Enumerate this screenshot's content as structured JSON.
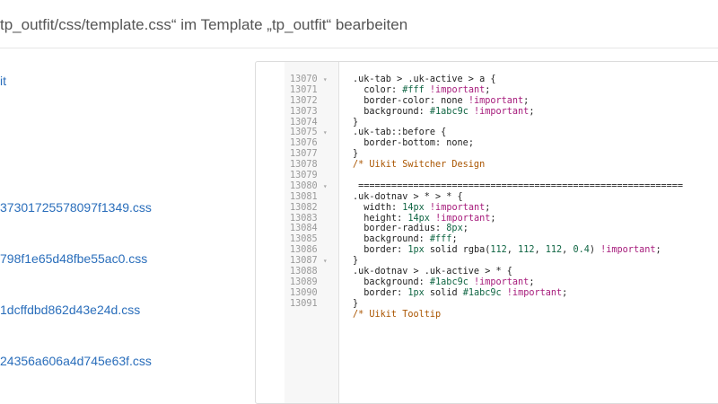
{
  "header": {
    "title": "tp_outfit/css/template.css“ im Template „tp_outfit“ bearbeiten"
  },
  "file_tree": {
    "items": [
      {
        "label": "it"
      },
      {
        "label": "37301725578097f1349.css"
      },
      {
        "label": "798f1e65d48fbe55ac0.css"
      },
      {
        "label": "1dcffdbd862d43e24d.css"
      },
      {
        "label": "24356a606a4d745e63f.css"
      }
    ]
  },
  "editor": {
    "lines": [
      {
        "num": "13070",
        "fold": "▾",
        "code": ".uk-tab > .uk-active > a {"
      },
      {
        "num": "13071",
        "fold": "",
        "code": "  color: #fff !important;"
      },
      {
        "num": "13072",
        "fold": "",
        "code": "  border-color: none !important;"
      },
      {
        "num": "13073",
        "fold": "",
        "code": "  background: #1abc9c !important;"
      },
      {
        "num": "13074",
        "fold": "",
        "code": "}"
      },
      {
        "num": "13075",
        "fold": "▾",
        "code": ".uk-tab::before {"
      },
      {
        "num": "13076",
        "fold": "",
        "code": "  border-bottom: none;"
      },
      {
        "num": "13077",
        "fold": "",
        "code": "}"
      },
      {
        "num": "13078",
        "fold": "",
        "code": "/* Uikit Switcher Design"
      },
      {
        "num": "13079",
        "fold": "",
        "code": ""
      },
      {
        "num": "13080",
        "fold": "▾",
        "code": " ==========================================================="
      },
      {
        "num": "13081",
        "fold": "",
        "code": ".uk-dotnav > * > * {"
      },
      {
        "num": "13082",
        "fold": "",
        "code": "  width: 14px !important;"
      },
      {
        "num": "13083",
        "fold": "",
        "code": "  height: 14px !important;"
      },
      {
        "num": "13084",
        "fold": "",
        "code": "  border-radius: 8px;"
      },
      {
        "num": "13085",
        "fold": "",
        "code": "  background: #fff;"
      },
      {
        "num": "13086",
        "fold": "",
        "code": "  border: 1px solid rgba(112, 112, 112, 0.4) !important;"
      },
      {
        "num": "13087",
        "fold": "▾",
        "code": "}"
      },
      {
        "num": "13088",
        "fold": "",
        "code": ".uk-dotnav > .uk-active > * {"
      },
      {
        "num": "13089",
        "fold": "",
        "code": "  background: #1abc9c !important;"
      },
      {
        "num": "13090",
        "fold": "",
        "code": "  border: 1px solid #1abc9c !important;"
      },
      {
        "num": "13091",
        "fold": "",
        "code": "}"
      },
      {
        "num": "",
        "fold": "",
        "code": "/* Uikit Tooltip"
      }
    ]
  },
  "colors": {
    "link": "#2a6ebb",
    "title": "#555555",
    "comment": "#aa5500",
    "important": "#a61b7b",
    "value": "#116644"
  }
}
